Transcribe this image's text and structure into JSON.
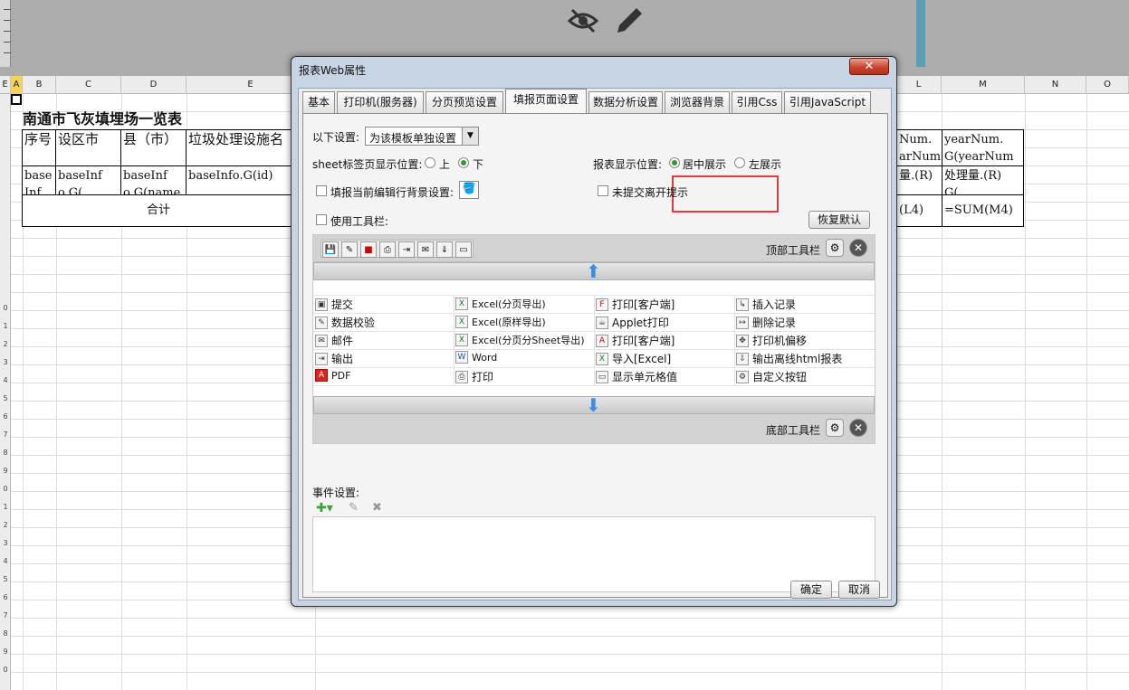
{
  "sheet": {
    "columns": [
      "A",
      "B",
      "C",
      "D",
      "E",
      "L",
      "M",
      "N",
      "O"
    ],
    "title": "南通市飞灰填埋场一览表",
    "headers": [
      "序号",
      "设区市",
      "县（市）",
      "垃圾处理设施名",
      "Num.\narNum",
      "yearNum.\nG(yearNum"
    ],
    "row1": [
      "base\nInf",
      "baseInf\no.G(",
      "baseInf\no.G(name",
      "baseInfo.G(id)",
      "量.(R)",
      "处理量.(R)\nG("
    ],
    "total_label": "合计",
    "total_l": "(L4)",
    "total_m": "=SUM(M4)"
  },
  "dialog": {
    "title": "报表Web属性",
    "close_label": "✕",
    "tabs": [
      "基本",
      "打印机(服务器)",
      "分页预览设置",
      "填报页面设置",
      "数据分析设置",
      "浏览器背景",
      "引用Css",
      "引用JavaScript"
    ],
    "active_tab": "填报页面设置",
    "settings_label": "以下设置:",
    "settings_value": "为该模板单独设置",
    "sheet_pos_label": "sheet标签页显示位置:",
    "sheet_pos_up": "上",
    "sheet_pos_down": "下",
    "report_pos_label": "报表显示位置:",
    "report_pos_center": "居中展示",
    "report_pos_left": "左展示",
    "fill_bg_label": "填报当前编辑行背景设置:",
    "unsubmit_label": "未提交离开提示",
    "use_toolbar_label": "使用工具栏:",
    "restore_default": "恢复默认",
    "top_toolbar_label": "顶部工具栏",
    "bottom_toolbar_label": "底部工具栏",
    "toolbar_items": [
      [
        "提交",
        "Excel(分页导出)",
        "打印[客户端]",
        "插入记录"
      ],
      [
        "数据校验",
        "Excel(原样导出)",
        "Applet打印",
        "删除记录"
      ],
      [
        "邮件",
        "Excel(分页分Sheet导出)",
        "打印[客户端]",
        "打印机偏移"
      ],
      [
        "输出",
        "Word",
        "导入[Excel]",
        "输出离线html报表"
      ],
      [
        "PDF",
        "打印",
        "显示单元格值",
        "自定义按钮"
      ]
    ],
    "event_label": "事件设置:",
    "ok": "确定",
    "cancel": "取消"
  }
}
